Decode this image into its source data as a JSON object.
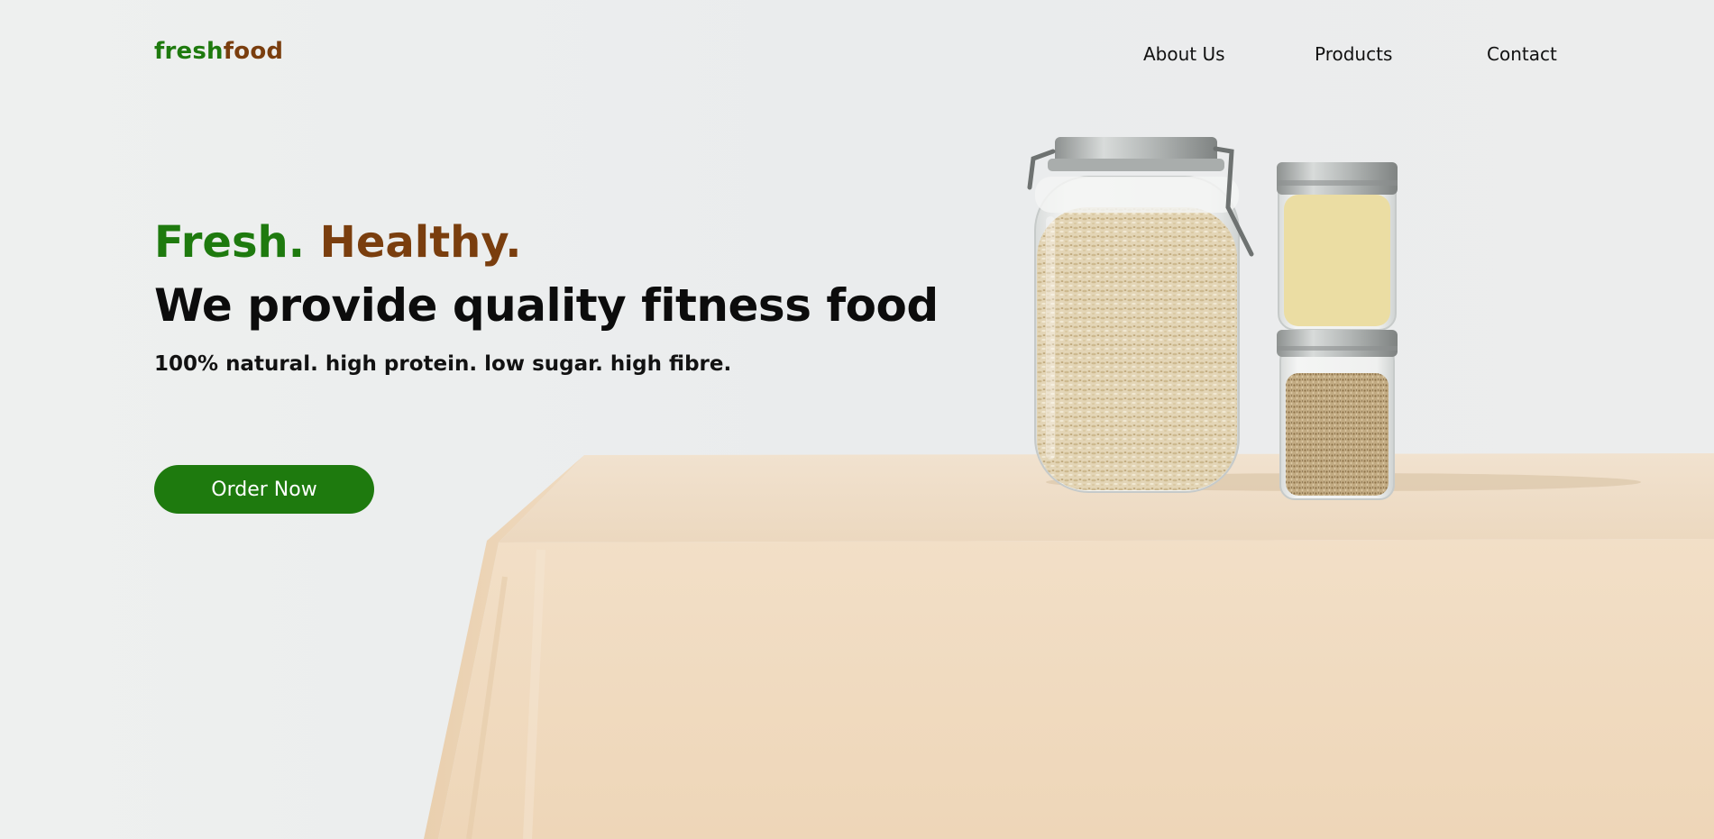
{
  "brand": {
    "logo_part_fresh": "fresh",
    "logo_part_food": "food"
  },
  "nav": {
    "items": [
      {
        "label": "About Us"
      },
      {
        "label": "Products"
      },
      {
        "label": "Contact"
      }
    ]
  },
  "hero": {
    "tagline_fresh": "Fresh.",
    "tagline_healthy": "Healthy.",
    "headline": "We provide quality fitness food",
    "subline": "100% natural. high protein. low sugar. high fibre.",
    "cta_label": "Order Now"
  },
  "colors": {
    "brand_green": "#1e7a0e",
    "brand_brown": "#7a3e0e",
    "background": "#eceeee",
    "tablecloth": "#efdcc4"
  }
}
